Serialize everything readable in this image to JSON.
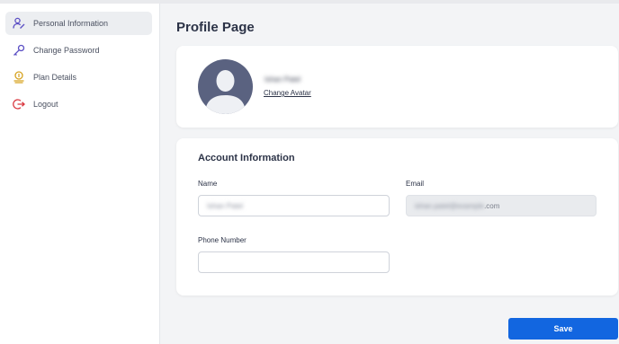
{
  "sidebar": {
    "items": [
      {
        "label": "Personal Information",
        "icon": "user-edit-icon",
        "active": true
      },
      {
        "label": "Change Password",
        "icon": "key-icon",
        "active": false
      },
      {
        "label": "Plan Details",
        "icon": "coin-stack-icon",
        "active": false
      },
      {
        "label": "Logout",
        "icon": "logout-icon",
        "active": false
      }
    ]
  },
  "page": {
    "title": "Profile Page"
  },
  "profile": {
    "name": "Ishan Patel",
    "change_avatar_label": "Change Avatar"
  },
  "account": {
    "section_title": "Account Information",
    "name_label": "Name",
    "name_value": "Ishan Patel",
    "email_label": "Email",
    "email_value_hidden": "ishan.patel@example",
    "email_value_suffix": ".com",
    "phone_label": "Phone Number",
    "phone_value": ""
  },
  "actions": {
    "save_label": "Save"
  },
  "colors": {
    "accent": "#1266e0",
    "avatar_bg": "#5a6280",
    "sidebar_icon_purple": "#5b4fc4",
    "sidebar_icon_gold": "#d6a21f",
    "sidebar_icon_red": "#d9363e"
  }
}
